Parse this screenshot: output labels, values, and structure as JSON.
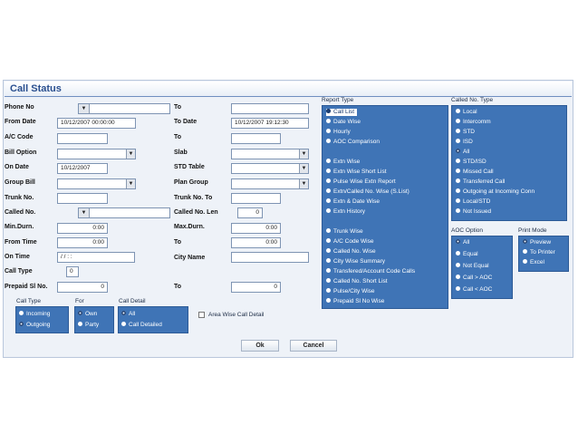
{
  "window": {
    "title": "Call Status"
  },
  "form": {
    "phone_no_label": "Phone No",
    "to1_label": "To",
    "from_date_label": "From Date",
    "from_date_value": "10/12/2007 00:00:00",
    "to_date_label": "To Date",
    "to_date_value": "10/12/2007 19:12:30",
    "ac_code_label": "A/C Code",
    "to2_label": "To",
    "bill_option_label": "Bill Option",
    "slab_label": "Slab",
    "on_date_label": "On Date",
    "on_date_value": "10/12/2007",
    "std_table_label": "STD Table",
    "group_bill_label": "Group Bill",
    "plan_group_label": "Plan Group",
    "trunk_no_label": "Trunk No.",
    "trunk_no_to_label": "Trunk No. To",
    "called_no_label": "Called No.",
    "called_no_len_label": "Called No. Len",
    "called_no_len_value": "0",
    "min_durn_label": "Min.Durn.",
    "min_durn_value": "0:00",
    "max_durn_label": "Max.Durn.",
    "max_durn_value": "0:00",
    "from_time_label": "From Time",
    "from_time_value": "0:00",
    "to3_label": "To",
    "to3_value": "0:00",
    "on_time_label": "On Time",
    "on_time_value": "/ /     : :",
    "city_name_label": "City Name",
    "call_type_label": "Call Type",
    "call_type_value": "0",
    "prepaid_label": "Prepaid Sl No.",
    "prepaid_value": "0",
    "to4_label": "To",
    "to4_value": "0"
  },
  "call_type_group": {
    "title": "Call Type",
    "options": [
      "Incoming",
      "Outgoing"
    ]
  },
  "for_group": {
    "title": "For",
    "options": [
      "Own",
      "Party"
    ]
  },
  "call_detail_group": {
    "title": "Call Detail",
    "options": [
      "All",
      "Call Detailed"
    ]
  },
  "area_wise_label": "Area Wise Call Detail",
  "report_type": {
    "title": "Report Type",
    "options": [
      "Call List",
      "Date Wise",
      "Hourly",
      "AOC Comparison",
      "",
      "Extn Wise",
      "Extn Wise Short List",
      "Pulse Wise Extn Report",
      "Extn/Called No. Wise (S.List)",
      "Extn & Date Wise",
      "Extn History",
      "",
      "Trunk Wise",
      "A/C Code Wise",
      "Called No. Wise",
      "City Wise Summary",
      "Transfered/Account Code Calls",
      "Called No. Short List",
      "Pulse/City Wise",
      "Prepaid Sl No Wise"
    ]
  },
  "called_no_type": {
    "title": "Called No. Type",
    "options": [
      "Local",
      "Intercomm",
      "STD",
      "ISD",
      "All",
      "STD/ISD",
      "Missed Call",
      "Transferred Call",
      "Outgoing at Incoming Conn",
      "Local/STD",
      "Not Issued"
    ]
  },
  "aoc_option": {
    "title": "AOC Option",
    "options": [
      "All",
      "Equal",
      "Not Equal",
      "Call > AOC",
      "Call < AOC"
    ]
  },
  "print_mode": {
    "title": "Print Mode",
    "options": [
      "Preview",
      "To Printer",
      "Excel"
    ]
  },
  "buttons": {
    "ok": "Ok",
    "cancel": "Cancel"
  },
  "dropdown_glyph": "▼"
}
